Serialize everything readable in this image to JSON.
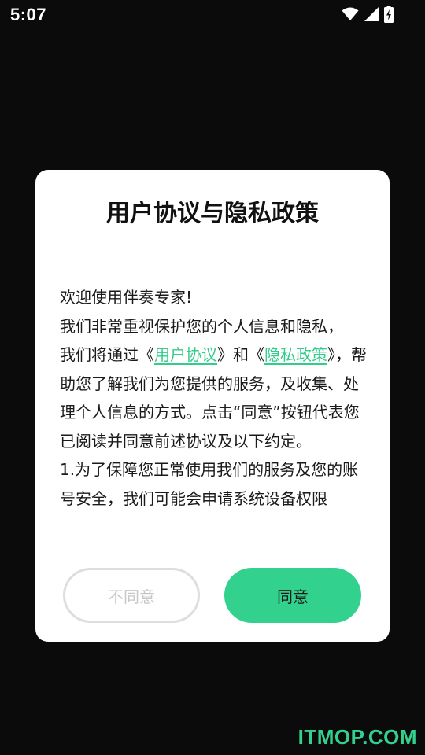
{
  "status_bar": {
    "time": "5:07",
    "icons": [
      "wifi-icon",
      "signal-icon",
      "battery-charging-icon"
    ]
  },
  "dialog": {
    "title": "用户协议与隐私政策",
    "body": {
      "greeting": "欢迎使用伴奏专家!",
      "line2": "我们非常重视保护您的个人信息和隐私，",
      "line3_pre": "我们将通过《",
      "user_agreement_link": "用户协议",
      "line3_mid": "》和《",
      "privacy_link": "隐私政策",
      "line3_post": "》，帮助您了解我们为您提供的服务，及收集、处理个人信息的方式。点击“同意”按钮代表您已阅读并同意前述协议及以下约定。",
      "clause1": "1.为了保障您正常使用我们的服务及您的账号安全，我们可能会申请系统设备权限"
    },
    "disagree_label": "不同意",
    "agree_label": "同意"
  },
  "watermark": "ITMOP.COM",
  "colors": {
    "accent": "#33d18e",
    "background": "#0b0b0c",
    "dialog": "#ffffff"
  }
}
